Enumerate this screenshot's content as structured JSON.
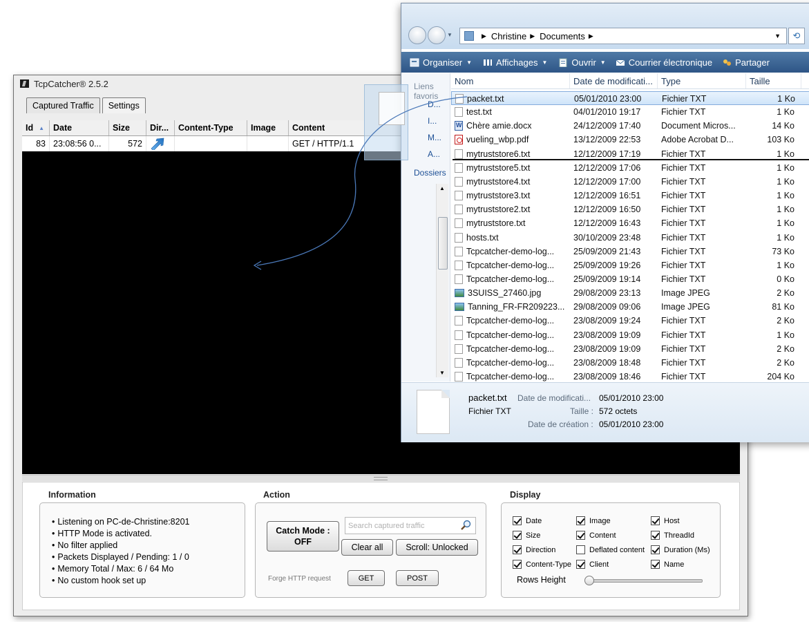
{
  "tcpcatcher": {
    "title": "TcpCatcher® 2.5.2",
    "tabs": [
      "Captured Traffic",
      "Settings"
    ],
    "columns": [
      "Id",
      "Date",
      "Size",
      "Dir...",
      "Content-Type",
      "Image",
      "Content"
    ],
    "rows": [
      {
        "id": "83",
        "date": "23:08:56 0...",
        "size": "572",
        "content_type": "",
        "image": "",
        "content": "GET / HTTP/1.1"
      }
    ],
    "information": {
      "label": "Information",
      "lines": [
        "Listening on PC-de-Christine:8201",
        "HTTP Mode is activated.",
        "No filter applied",
        "Packets Displayed / Pending: 1 / 0",
        "Memory Total / Max: 6 / 64 Mo",
        "No custom hook set up"
      ]
    },
    "action": {
      "label": "Action",
      "catch_mode_line1": "Catch Mode :",
      "catch_mode_line2": "OFF",
      "search_placeholder": "Search captured traffic",
      "clear_all": "Clear all",
      "scroll": "Scroll: Unlocked",
      "forge_label": "Forge HTTP request",
      "get": "GET",
      "post": "POST"
    },
    "display": {
      "label": "Display",
      "checkboxes": [
        {
          "label": "Date",
          "checked": true
        },
        {
          "label": "Image",
          "checked": true
        },
        {
          "label": "Host",
          "checked": true
        },
        {
          "label": "Size",
          "checked": true
        },
        {
          "label": "Content",
          "checked": true
        },
        {
          "label": "ThreadId",
          "checked": true
        },
        {
          "label": "Direction",
          "checked": true
        },
        {
          "label": "Deflated content",
          "checked": false
        },
        {
          "label": "Duration (Ms)",
          "checked": true
        },
        {
          "label": "Content-Type",
          "checked": true
        },
        {
          "label": "Client",
          "checked": true
        },
        {
          "label": "Name",
          "checked": true
        }
      ],
      "rows_height_label": "Rows Height",
      "rows_height_value": 0
    }
  },
  "explorer": {
    "breadcrumb": [
      "Christine",
      "Documents"
    ],
    "toolbar": [
      "Organiser",
      "Affichages",
      "Ouvrir",
      "Courrier électronique",
      "Partager"
    ],
    "nav_pane": {
      "favorites_header": "Liens favoris",
      "items": [
        "D...",
        "I...",
        "M...",
        "A..."
      ],
      "folders": "Dossiers"
    },
    "columns": [
      "Nom",
      "Date de modificati...",
      "Type",
      "Taille"
    ],
    "files": [
      {
        "name": "packet.txt",
        "date": "05/01/2010 23:00",
        "type": "Fichier TXT",
        "size": "1 Ko",
        "icon": "txt",
        "selected": true
      },
      {
        "name": "test.txt",
        "date": "04/01/2010 19:17",
        "type": "Fichier TXT",
        "size": "1 Ko",
        "icon": "txt"
      },
      {
        "name": "Chère amie.docx",
        "date": "24/12/2009 17:40",
        "type": "Document Micros...",
        "size": "14 Ko",
        "icon": "docx"
      },
      {
        "name": "vueling_wbp.pdf",
        "date": "13/12/2009 22:53",
        "type": "Adobe Acrobat D...",
        "size": "103 Ko",
        "icon": "pdf"
      },
      {
        "name": "mytruststore6.txt",
        "date": "12/12/2009 17:19",
        "type": "Fichier TXT",
        "size": "1 Ko",
        "icon": "txt"
      },
      {
        "name": "mytruststore5.txt",
        "date": "12/12/2009 17:06",
        "type": "Fichier TXT",
        "size": "1 Ko",
        "icon": "txt"
      },
      {
        "name": "mytruststore4.txt",
        "date": "12/12/2009 17:00",
        "type": "Fichier TXT",
        "size": "1 Ko",
        "icon": "txt"
      },
      {
        "name": "mytruststore3.txt",
        "date": "12/12/2009 16:51",
        "type": "Fichier TXT",
        "size": "1 Ko",
        "icon": "txt"
      },
      {
        "name": "mytruststore2.txt",
        "date": "12/12/2009 16:50",
        "type": "Fichier TXT",
        "size": "1 Ko",
        "icon": "txt"
      },
      {
        "name": "mytruststore.txt",
        "date": "12/12/2009 16:43",
        "type": "Fichier TXT",
        "size": "1 Ko",
        "icon": "txt"
      },
      {
        "name": "hosts.txt",
        "date": "30/10/2009 23:48",
        "type": "Fichier TXT",
        "size": "1 Ko",
        "icon": "txt"
      },
      {
        "name": "Tcpcatcher-demo-log...",
        "date": "25/09/2009 21:43",
        "type": "Fichier TXT",
        "size": "73 Ko",
        "icon": "txt"
      },
      {
        "name": "Tcpcatcher-demo-log...",
        "date": "25/09/2009 19:26",
        "type": "Fichier TXT",
        "size": "1 Ko",
        "icon": "txt"
      },
      {
        "name": "Tcpcatcher-demo-log...",
        "date": "25/09/2009 19:14",
        "type": "Fichier TXT",
        "size": "0 Ko",
        "icon": "txt"
      },
      {
        "name": "3SUISS_27460.jpg",
        "date": "29/08/2009 23:13",
        "type": "Image JPEG",
        "size": "2 Ko",
        "icon": "jpg"
      },
      {
        "name": "Tanning_FR-FR209223...",
        "date": "29/08/2009 09:06",
        "type": "Image JPEG",
        "size": "81 Ko",
        "icon": "jpg"
      },
      {
        "name": "Tcpcatcher-demo-log...",
        "date": "23/08/2009 19:24",
        "type": "Fichier TXT",
        "size": "2 Ko",
        "icon": "txt"
      },
      {
        "name": "Tcpcatcher-demo-log...",
        "date": "23/08/2009 19:09",
        "type": "Fichier TXT",
        "size": "1 Ko",
        "icon": "txt"
      },
      {
        "name": "Tcpcatcher-demo-log...",
        "date": "23/08/2009 19:09",
        "type": "Fichier TXT",
        "size": "2 Ko",
        "icon": "txt"
      },
      {
        "name": "Tcpcatcher-demo-log...",
        "date": "23/08/2009 18:48",
        "type": "Fichier TXT",
        "size": "2 Ko",
        "icon": "txt"
      },
      {
        "name": "Tcpcatcher-demo-log...",
        "date": "23/08/2009 18:46",
        "type": "Fichier TXT",
        "size": "204 Ko",
        "icon": "txt"
      }
    ],
    "preview": {
      "name": "packet.txt",
      "type": "Fichier TXT",
      "modified_label": "Date de modificati...",
      "modified_value": "05/01/2010 23:00",
      "size_label": "Taille :",
      "size_value": "572 octets",
      "created_label": "Date de création :",
      "created_value": "05/01/2010 23:00"
    }
  }
}
